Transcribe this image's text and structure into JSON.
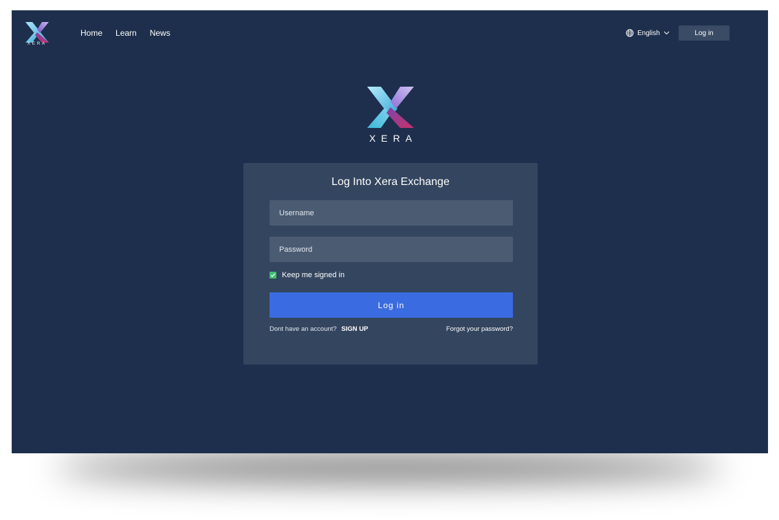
{
  "brand": {
    "logo_text": "XERA",
    "colors": {
      "background": "#1d2f4c",
      "card": "#33455f",
      "input": "#4a5b72",
      "primary": "#3b6be0",
      "checkbox": "#3fbf6f"
    }
  },
  "nav": {
    "links": [
      "Home",
      "Learn",
      "News"
    ],
    "language": "English",
    "login_label": "Log in"
  },
  "hero": {
    "logo_text": "XERA"
  },
  "login": {
    "title": "Log Into Xera Exchange",
    "username_placeholder": "Username",
    "password_placeholder": "Password",
    "keep_signed_in": "Keep me signed in",
    "keep_signed_in_checked": true,
    "submit_label": "Log in",
    "no_account_text": "Dont have an account?",
    "signup_label": "SIGN UP",
    "forgot_label": "Forgot your password?"
  }
}
